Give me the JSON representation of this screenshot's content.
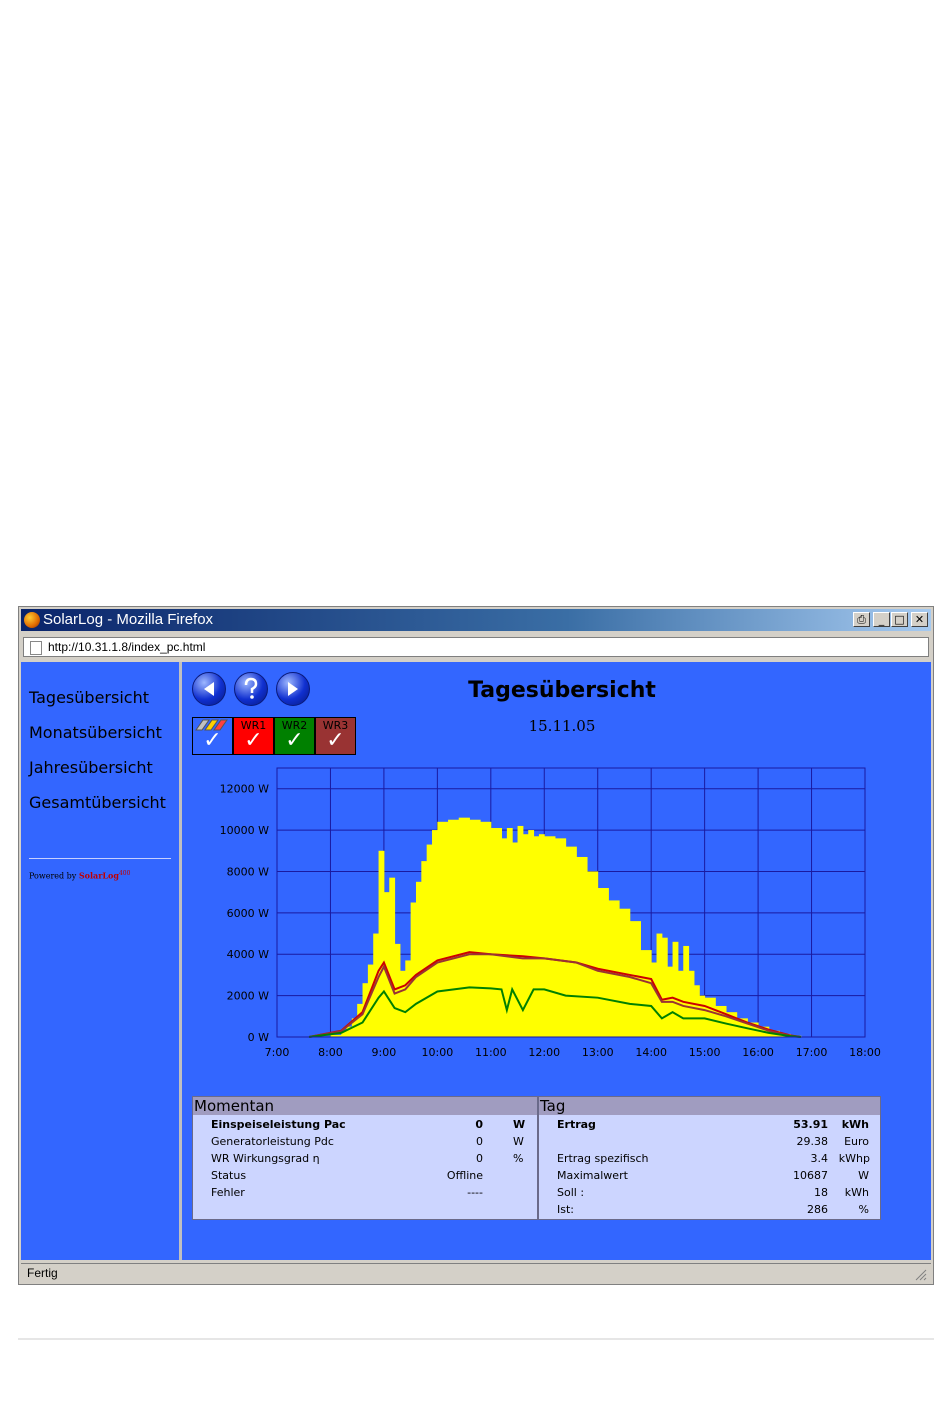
{
  "window": {
    "title": "SolarLog - Mozilla Firefox",
    "url": "http://10.31.1.8/index_pc.html",
    "status": "Fertig"
  },
  "sidebar": {
    "items": [
      {
        "label": "Tagesübersicht"
      },
      {
        "label": "Monatsübersicht"
      },
      {
        "label": "Jahresübersicht"
      },
      {
        "label": "Gesamtübersicht"
      }
    ],
    "powered_by": "Powered by",
    "brand": "SolarLog",
    "brand_sup": "400"
  },
  "page": {
    "title": "Tagesübersicht",
    "date": "15.11.05"
  },
  "inverters": [
    {
      "label": "",
      "color": "#3366ff"
    },
    {
      "label": "WR1",
      "color": "#ff0000"
    },
    {
      "label": "WR2",
      "color": "#008000"
    },
    {
      "label": "WR3",
      "color": "#993333"
    }
  ],
  "colors": {
    "background": "#3366ff",
    "bars": "#ffff00",
    "grid": "#1a1aa0",
    "line_wr1": "#cc0000",
    "line_wr2": "#993333",
    "line_wr3": "#008000"
  },
  "chart_data": {
    "type": "bar",
    "x_ticks": [
      "7:00",
      "8:00",
      "9:00",
      "10:00",
      "11:00",
      "12:00",
      "13:00",
      "14:00",
      "15:00",
      "16:00",
      "17:00",
      "18:00"
    ],
    "y_ticks": [
      "0 W",
      "2000 W",
      "4000 W",
      "6000 W",
      "8000 W",
      "10000 W",
      "12000 W"
    ],
    "xlim": [
      7,
      18
    ],
    "ylim": [
      0,
      13000
    ],
    "grid": true,
    "bars": {
      "x": [
        7.6,
        8.0,
        8.2,
        8.3,
        8.4,
        8.5,
        8.6,
        8.7,
        8.8,
        8.9,
        9.0,
        9.1,
        9.2,
        9.3,
        9.4,
        9.5,
        9.6,
        9.7,
        9.8,
        9.9,
        10.0,
        10.2,
        10.4,
        10.6,
        10.8,
        11.0,
        11.2,
        11.3,
        11.4,
        11.5,
        11.6,
        11.7,
        11.8,
        11.9,
        12.0,
        12.2,
        12.4,
        12.6,
        12.8,
        13.0,
        13.2,
        13.4,
        13.6,
        13.8,
        14.0,
        14.1,
        14.2,
        14.3,
        14.4,
        14.5,
        14.6,
        14.7,
        14.8,
        14.9,
        15.0,
        15.2,
        15.4,
        15.6,
        15.8,
        16.0,
        16.2,
        16.4,
        16.6,
        16.8
      ],
      "values": [
        0,
        100,
        300,
        500,
        900,
        1600,
        2600,
        3500,
        5000,
        9000,
        7000,
        7700,
        4500,
        3200,
        3700,
        6500,
        7500,
        8500,
        9300,
        10000,
        10400,
        10500,
        10600,
        10500,
        10400,
        10100,
        9600,
        10100,
        9400,
        10200,
        9800,
        10000,
        9700,
        9800,
        9700,
        9600,
        9200,
        8700,
        8000,
        7200,
        6600,
        6200,
        5600,
        4200,
        3600,
        5000,
        4800,
        3400,
        4600,
        3200,
        4400,
        3200,
        2500,
        2000,
        1900,
        1500,
        1200,
        900,
        700,
        500,
        300,
        150,
        60,
        0
      ]
    },
    "series": [
      {
        "name": "WR1",
        "x": [
          7.6,
          8.2,
          8.6,
          8.9,
          9.0,
          9.2,
          9.4,
          9.6,
          10.0,
          10.6,
          11.0,
          11.6,
          12.0,
          12.6,
          13.0,
          13.6,
          14.0,
          14.2,
          14.4,
          14.6,
          15.0,
          15.4,
          15.8,
          16.2,
          16.6,
          16.8
        ],
        "values": [
          0,
          300,
          1200,
          3200,
          3600,
          2300,
          2500,
          3000,
          3700,
          4100,
          4000,
          3900,
          3800,
          3600,
          3300,
          3000,
          2800,
          1800,
          1900,
          1700,
          1500,
          1100,
          700,
          350,
          80,
          0
        ]
      },
      {
        "name": "WR2",
        "x": [
          7.6,
          8.2,
          8.6,
          8.9,
          9.0,
          9.2,
          9.4,
          9.6,
          10.0,
          10.6,
          11.0,
          11.6,
          12.0,
          12.6,
          13.0,
          13.6,
          14.0,
          14.2,
          14.4,
          14.6,
          15.0,
          15.4,
          15.8,
          16.2,
          16.6,
          16.8
        ],
        "values": [
          0,
          280,
          1100,
          2900,
          3400,
          2100,
          2300,
          2900,
          3600,
          4000,
          4000,
          3800,
          3800,
          3600,
          3200,
          2900,
          2600,
          1700,
          1700,
          1500,
          1300,
          1000,
          650,
          300,
          60,
          0
        ]
      },
      {
        "name": "WR3",
        "x": [
          7.6,
          8.2,
          8.6,
          8.9,
          9.0,
          9.2,
          9.4,
          9.6,
          10.0,
          10.6,
          11.0,
          11.2,
          11.3,
          11.4,
          11.6,
          11.8,
          12.0,
          12.4,
          13.0,
          13.6,
          14.0,
          14.2,
          14.4,
          14.6,
          15.0,
          15.4,
          15.8,
          16.2,
          16.6,
          16.8
        ],
        "values": [
          0,
          200,
          700,
          1900,
          2200,
          1400,
          1200,
          1600,
          2200,
          2400,
          2350,
          2300,
          1300,
          2300,
          1300,
          2300,
          2300,
          2000,
          1900,
          1600,
          1500,
          900,
          1200,
          900,
          900,
          650,
          420,
          200,
          40,
          0
        ]
      }
    ]
  },
  "momentan": {
    "title": "Momentan",
    "rows": [
      {
        "label": "Einspeiseleistung Pac",
        "value": "0",
        "unit": "W",
        "bold": true
      },
      {
        "label": "Generatorleistung Pdc",
        "value": "0",
        "unit": "W"
      },
      {
        "label": "WR Wirkungsgrad η",
        "value": "0",
        "unit": "%"
      },
      {
        "label": "Status",
        "value": "Offline",
        "unit": ""
      },
      {
        "label": "Fehler",
        "value": "----",
        "unit": ""
      }
    ]
  },
  "tag": {
    "title": "Tag",
    "rows": [
      {
        "label": "Ertrag",
        "value": "53.91",
        "unit": "kWh",
        "bold": true
      },
      {
        "label": "",
        "value": "29.38",
        "unit": "Euro"
      },
      {
        "label": "Ertrag spezifisch",
        "value": "3.4",
        "unit": "kWhp"
      },
      {
        "label": "Maximalwert",
        "value": "10687",
        "unit": "W"
      },
      {
        "label": "Soll :",
        "value": "18",
        "unit": "kWh"
      },
      {
        "label": "Ist:",
        "value": "286",
        "unit": "%"
      }
    ]
  }
}
